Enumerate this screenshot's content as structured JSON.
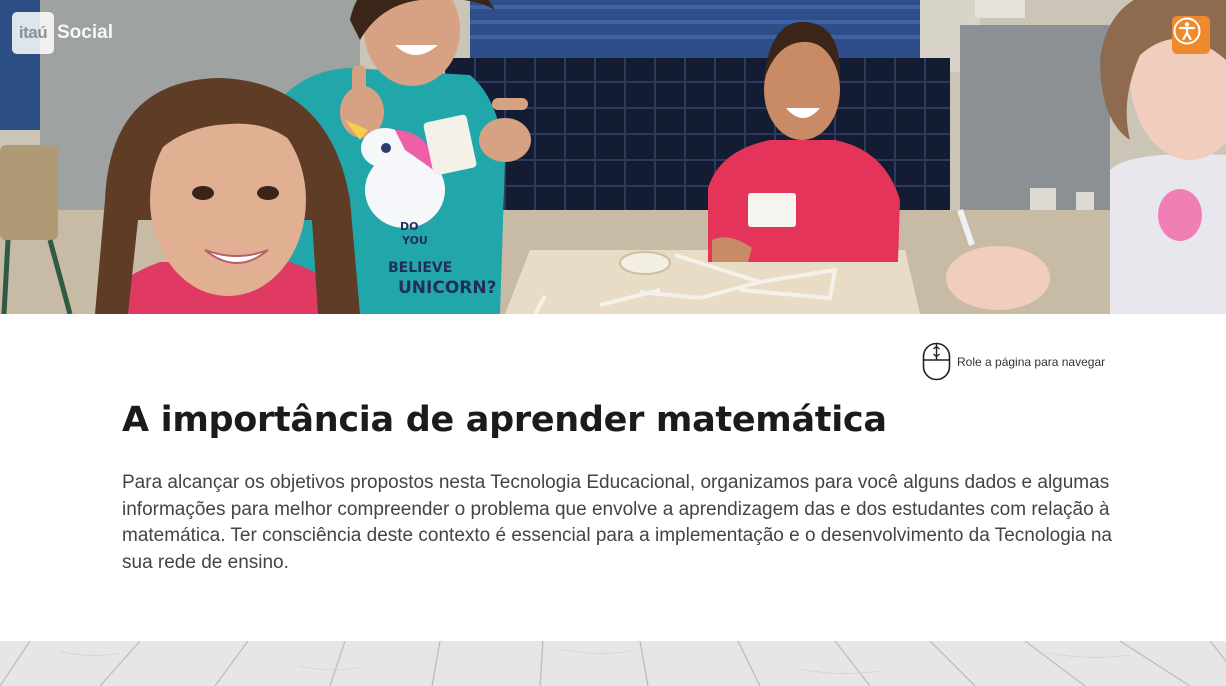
{
  "brand": {
    "logo_mark": "itaú",
    "logo_text": "Social"
  },
  "header": {
    "accessibility_icon": "accessibility-icon"
  },
  "scroll_hint": {
    "icon": "mouse-scroll-icon",
    "label": "Role a página para navegar"
  },
  "main": {
    "title": "A importância de aprender matemática",
    "intro": "Para alcançar os objetivos propostos nesta Tecnologia Educacional, organizamos para você alguns dados e algumas informações para melhor compreender o problema que envolve a aprendizagem das e dos estudantes com relação à matemática. Ter consciência deste contexto é essencial para a implementação e o desenvolvimento da Tecnologia na sua rede de ensino."
  },
  "photo": {
    "shirt_text": [
      "DO",
      "YOU",
      "BELIEVE",
      "UNICORN?"
    ]
  },
  "colors": {
    "accent": "#ef8a2c",
    "title": "#1b1b1b",
    "body_text": "#444444"
  }
}
